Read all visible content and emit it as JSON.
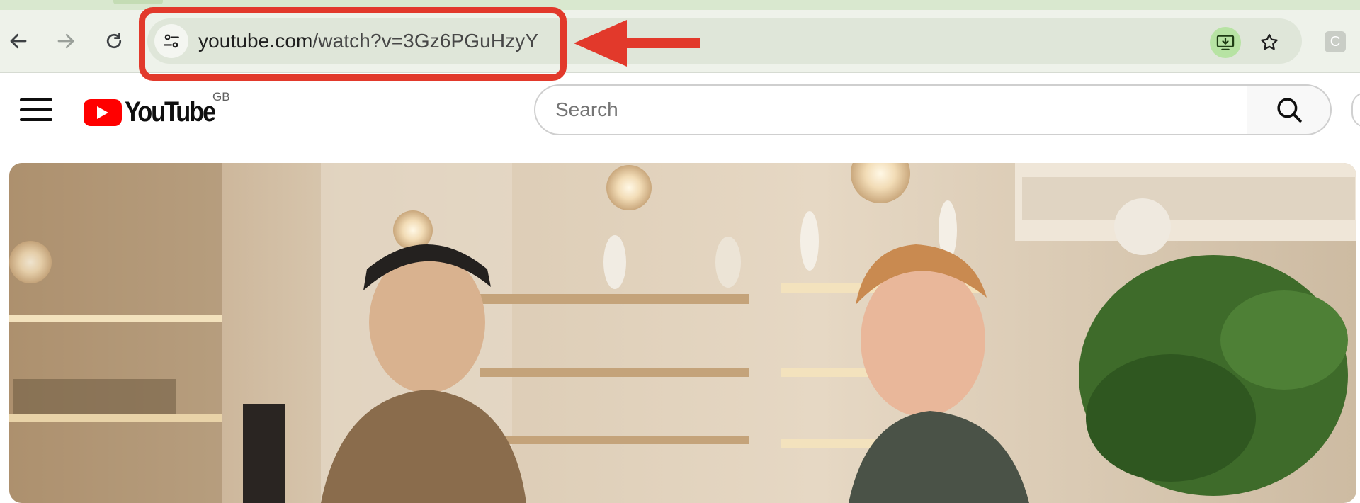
{
  "browser": {
    "url_domain": "youtube.com",
    "url_path": "/watch?v=3Gz6PGuHzyY",
    "extension_label": "C",
    "icons": [
      "back-icon",
      "forward-icon",
      "reload-icon",
      "site-settings-icon",
      "install-app-icon",
      "bookmark-star-icon",
      "extension-icon"
    ],
    "accent_color": "#b7e3a3"
  },
  "annotation": {
    "color": "#e2392b",
    "shape": "rounded-rectangle-with-arrow"
  },
  "youtube": {
    "logo_text": "YouTube",
    "country_code": "GB",
    "search_placeholder": "Search",
    "brand_color": "#ff0000",
    "icons": [
      "menu-icon",
      "youtube-play-icon",
      "search-icon"
    ]
  },
  "video": {
    "description_hidden": true
  }
}
